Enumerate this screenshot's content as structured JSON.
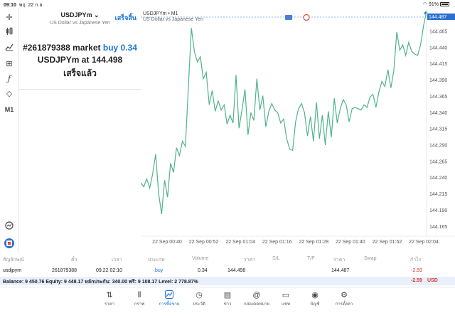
{
  "status": {
    "time": "09:10",
    "date": "พฤ. 22 ก.ย.",
    "battery": "91%"
  },
  "left_toolbar": {
    "timeframe": "M1"
  },
  "order_panel": {
    "symbol": "USDJPYm",
    "description": "US Dollar vs Japanese Yen",
    "done_button": "เสร็จสิ้น",
    "ticket_text": "#261879388 market",
    "side": "buy",
    "volume": "0.34",
    "at_prefix": "USDJPYm at",
    "price": "144.498",
    "result": "เสร็จแล้ว"
  },
  "chart_header": {
    "symbol": "USDJPYm",
    "timeframe": "M1",
    "description": "US Dollar vs Japanese Yen"
  },
  "chart_data": {
    "type": "line",
    "x_labels": [
      "22 Sep 00:40",
      "22 Sep 00:52",
      "22 Sep 01:04",
      "22 Sep 01:16",
      "22 Sep 01:28",
      "22 Sep 01:40",
      "22 Sep 01:52",
      "22 Sep 02:04"
    ],
    "y_ticks": [
      "144.487",
      "144.465",
      "144.440",
      "144.415",
      "144.390",
      "144.365",
      "144.340",
      "144.315",
      "144.290",
      "144.265",
      "144.240",
      "144.215",
      "144.190",
      "144.165"
    ],
    "ylim": [
      144.15,
      144.5
    ],
    "current_price": "144.487",
    "line_color": "#4fb38a",
    "values": [
      144.232,
      144.226,
      144.238,
      144.224,
      144.246,
      144.276,
      144.216,
      144.184,
      144.236,
      144.21,
      144.262,
      144.248,
      144.286,
      144.274,
      144.296,
      144.288,
      144.38,
      144.47,
      144.434,
      144.418,
      144.426,
      144.392,
      144.402,
      144.352,
      144.374,
      144.342,
      144.358,
      144.344,
      144.352,
      144.322,
      144.336,
      144.324,
      144.398,
      144.316,
      144.344,
      144.376,
      144.306,
      144.34,
      144.328,
      144.392,
      144.344,
      144.366,
      144.318,
      144.342,
      144.354,
      144.344,
      144.34,
      144.324,
      144.33,
      144.3,
      144.284,
      144.282,
      144.326,
      144.346,
      144.354,
      144.34,
      144.304,
      144.334,
      144.296,
      144.356,
      144.3,
      144.336,
      144.29,
      144.342,
      144.302,
      144.362,
      144.324,
      144.346,
      144.36,
      144.352,
      144.326,
      144.346,
      144.348,
      144.346,
      144.344,
      144.352,
      144.348,
      144.364,
      144.368,
      144.348,
      144.372,
      144.388,
      144.38,
      144.406,
      144.378,
      144.404,
      144.464,
      144.436,
      144.444,
      144.428,
      144.448,
      144.434,
      144.43,
      144.428,
      144.444,
      144.474,
      144.496
    ]
  },
  "positions_table": {
    "headers": [
      "สัญลักษณ์",
      "ตั๋ว",
      "เวลา",
      "ประเภท",
      "Volume",
      "ราคา",
      "S/L",
      "T/P",
      "ราคา",
      "Swap",
      "กำไร"
    ],
    "row": [
      "usdjpym",
      "261879388",
      "09.22 02:10",
      "buy",
      "0.34",
      "144.498",
      "",
      "",
      "144.487",
      "",
      "-2.59"
    ]
  },
  "balance_bar": {
    "text": "Balance: 9 450.76 Equity: 9 448.17 หลักประกัน: 340.00 ฟรี: 9 108.17 Level: 2 778.87%",
    "profit": "-2.59",
    "currency": "USD"
  },
  "tabs": [
    {
      "label": "ราคา",
      "icon": "arrows-updown-icon"
    },
    {
      "label": "กราฟ",
      "icon": "chart-icon"
    },
    {
      "label": "การซื้อขาย",
      "icon": "trade-icon",
      "active": true
    },
    {
      "label": "ประวัติ",
      "icon": "history-icon"
    },
    {
      "label": "ข่าว",
      "icon": "news-icon"
    },
    {
      "label": "กล่องจดหมาย",
      "icon": "mail-icon"
    },
    {
      "label": "แชท",
      "icon": "chat-icon"
    },
    {
      "label": "บัญชี",
      "icon": "account-icon"
    },
    {
      "label": "การตั้งค่า",
      "icon": "settings-icon"
    }
  ],
  "colors": {
    "accent": "#1a73d9",
    "loss": "#d9342b",
    "line": "#4fb38a",
    "balance_bg": "#e8f0fb"
  }
}
